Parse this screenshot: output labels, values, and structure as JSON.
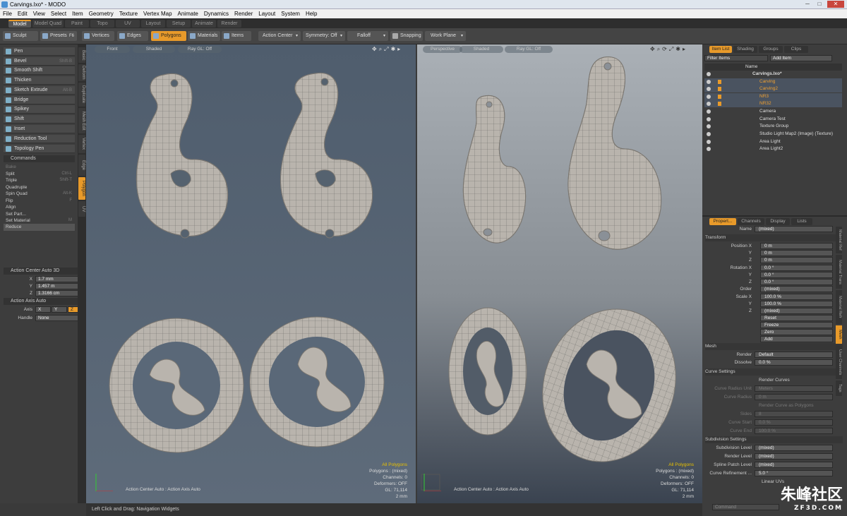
{
  "window": {
    "title": "Carvings.lxo* - MODO",
    "buttons": [
      "─",
      "□",
      "✕"
    ]
  },
  "menu": [
    "File",
    "Edit",
    "View",
    "Select",
    "Item",
    "Geometry",
    "Texture",
    "Vertex Map",
    "Animate",
    "Dynamics",
    "Render",
    "Layout",
    "System",
    "Help"
  ],
  "layout_tabs": [
    "Model",
    "Model Quad",
    "Paint",
    "Topo",
    "UV",
    "Layout",
    "Setup",
    "Animate",
    "Render"
  ],
  "toolbar": {
    "sculpt": "Sculpt",
    "presets": "Presets",
    "presets_key": "F6",
    "vertices": "Vertices",
    "edges": "Edges",
    "polygons": "Polygons",
    "materials": "Materials",
    "items": "Items",
    "action_center": "Action Center",
    "symmetry": "Symmetry: Off",
    "falloff": "Falloff",
    "snapping": "Snapping",
    "work_plane": "Work Plane"
  },
  "tools": [
    {
      "label": "Pen",
      "key": ""
    },
    {
      "label": "Bevel",
      "key": "Shift-B"
    },
    {
      "label": "Smooth Shift",
      "key": ""
    },
    {
      "label": "Thicken",
      "key": ""
    },
    {
      "label": "Sketch Extrude",
      "key": "Alt-B"
    },
    {
      "label": "Bridge",
      "key": ""
    },
    {
      "label": "Spikey",
      "key": ""
    },
    {
      "label": "Shift",
      "key": ""
    },
    {
      "label": "Inset",
      "key": ""
    },
    {
      "label": "Reduction Tool",
      "key": ""
    },
    {
      "label": "Topology Pen",
      "key": ""
    }
  ],
  "commands_header": "Commands",
  "commands": [
    {
      "label": "Bake",
      "key": ""
    },
    {
      "label": "Split",
      "key": "Ctrl-L"
    },
    {
      "label": "Triple",
      "key": "Shift-T"
    },
    {
      "label": "Quadruple",
      "key": ""
    },
    {
      "label": "Spin Quad",
      "key": "Alt-K"
    },
    {
      "label": "Flip",
      "key": "F"
    },
    {
      "label": "Align",
      "key": ""
    },
    {
      "label": "Set Part...",
      "key": ""
    },
    {
      "label": "Set Material",
      "key": "M"
    },
    {
      "label": "Reduce",
      "key": ""
    }
  ],
  "left_vtabs": [
    "Basic",
    "Deform",
    "Duplicate",
    "Mesh Edit",
    "Vertex",
    "Edge",
    "Polygon",
    "UV"
  ],
  "action_center": {
    "header": "Action Center Auto 3D",
    "x": "1.7 mm",
    "y": "1.457 m",
    "z": "1.3166 cm",
    "xl": "X",
    "yl": "Y",
    "zl": "Z"
  },
  "action_axis": {
    "header": "Action Axis Auto",
    "axis_label": "Axis",
    "axes": [
      "X",
      "Y",
      "Z"
    ],
    "handle_label": "Handle",
    "handle": "None"
  },
  "viewport_left": {
    "view": "Front",
    "shading": "Shaded",
    "raygl": "Ray GL: Off",
    "footer": "Action Center Auto : Action Axis Auto",
    "info": {
      "title": "All Polygons",
      "polygons": "Polygons : (mixed)",
      "channels": "Channels: 0",
      "deformers": "Deformers: OFF",
      "gl": "GL: 71,114",
      "scale": "2 mm"
    }
  },
  "viewport_right": {
    "view": "Perspective",
    "shading": "Shaded",
    "raygl": "Ray GL: Off",
    "footer": "Action Center Auto : Action Axis Auto",
    "info": {
      "title": "All Polygons",
      "polygons": "Polygons : (mixed)",
      "channels": "Channels: 0",
      "deformers": "Deformers: OFF",
      "gl": "GL: 71,114",
      "scale": "2 mm"
    }
  },
  "status": "Left Click and Drag:  Navigation Widgets",
  "item_list": {
    "tabs": [
      "Item List",
      "Shading",
      "Groups",
      "Clips"
    ],
    "filter": "Filter Items",
    "add": "Add Item",
    "col_name": "Name",
    "items": [
      {
        "name": "Carvings.lxo*",
        "orange": false
      },
      {
        "name": "Carving",
        "orange": true
      },
      {
        "name": "Carving2",
        "orange": true
      },
      {
        "name": "NR3",
        "orange": true
      },
      {
        "name": "NR32",
        "orange": true
      },
      {
        "name": "Camera",
        "orange": false
      },
      {
        "name": "Camera Test",
        "orange": false
      },
      {
        "name": "Texture Group",
        "orange": false
      },
      {
        "name": "Studio Light Map2 (Image) (Texture)",
        "orange": false
      },
      {
        "name": "Area Light",
        "orange": false
      },
      {
        "name": "Area Light2",
        "orange": false
      }
    ]
  },
  "properties": {
    "tabs": [
      "Propert...",
      "Channels",
      "Display",
      "Lists"
    ],
    "name_label": "Name",
    "name": "(mixed)",
    "transform": "Transform",
    "position": "Position",
    "rotation": "Rotation",
    "order_label": "Order",
    "order": "(mixed)",
    "scale": "Scale",
    "x": "X",
    "y": "Y",
    "z": "Z",
    "pos": [
      "0 m",
      "0 m",
      "0 m"
    ],
    "rot": [
      "0.0 °",
      "0.0 °",
      "0.0 °"
    ],
    "scl": [
      "100.0 %",
      "100.0 %",
      "(mixed)"
    ],
    "actions": [
      "Reset",
      "Freeze",
      "Zero",
      "Add"
    ],
    "mesh": "Mesh",
    "render_label": "Render",
    "render": "Default",
    "dissolve_label": "Dissolve",
    "dissolve": "0.0 %",
    "curve_settings": "Curve Settings",
    "render_curves": "Render Curves",
    "curve_radius_unit_label": "Curve Radius Unit",
    "curve_radius_unit": "Meters",
    "curve_radius_label": "Curve Radius",
    "curve_radius": "0 m",
    "render_curve_polys": "Render Curve as Polygons",
    "sides_label": "Sides",
    "sides": "8",
    "curve_start_label": "Curve Start",
    "curve_start": "0.0 %",
    "curve_end_label": "Curve End",
    "curve_end": "100.0 %",
    "subdiv": "Subdivision Settings",
    "subdiv_level_label": "Subdivision Level",
    "subdiv_level": "(mixed)",
    "render_level_label": "Render Level",
    "render_level": "(mixed)",
    "spline_label": "Spline Patch Level",
    "spline": "(mixed)",
    "curve_ref_label": "Curve Refinement  ...",
    "curve_ref": "5.0 °",
    "linear_uvs": "Linear UVs",
    "vtabs": [
      "Material Ref",
      "Material Trans",
      "Material Refr",
      "Mesh",
      "User Channels",
      "Tags"
    ]
  },
  "command_field": "Command",
  "watermark": {
    "main": "朱峰社区",
    "sub": "ZF3D.COM"
  }
}
